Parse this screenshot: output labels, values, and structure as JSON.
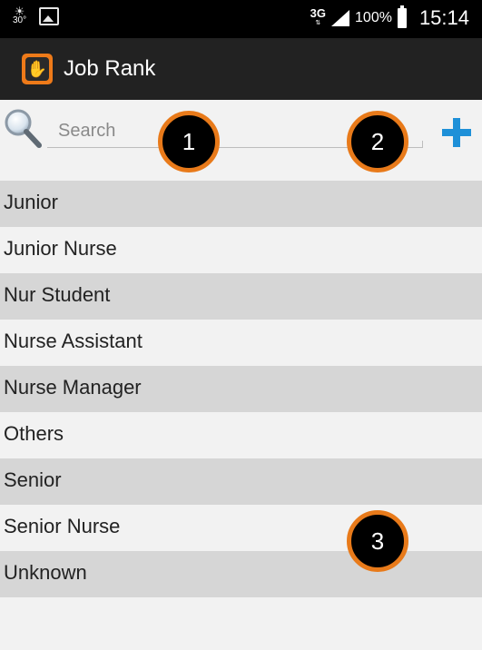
{
  "status_bar": {
    "weather_temp": "30°",
    "network": "3G",
    "network_arrows": "⇅",
    "battery_percent": "100%",
    "time": "15:14"
  },
  "action_bar": {
    "title": "Job Rank",
    "app_icon": "clapping-hands-icon"
  },
  "search": {
    "placeholder": "Search",
    "value": ""
  },
  "list": {
    "items": [
      "Junior",
      "Junior Nurse",
      "Nur Student",
      "Nurse Assistant",
      "Nurse Manager",
      "Others",
      "Senior",
      "Senior Nurse",
      "Unknown"
    ]
  },
  "annotations": {
    "markers": [
      "1",
      "2",
      "3"
    ],
    "marker_color": "#e87a1a"
  },
  "colors": {
    "accent": "#1e90d8",
    "app_icon": "#ee7a19",
    "action_bar": "#222222",
    "row_shaded": "#d6d6d6"
  }
}
